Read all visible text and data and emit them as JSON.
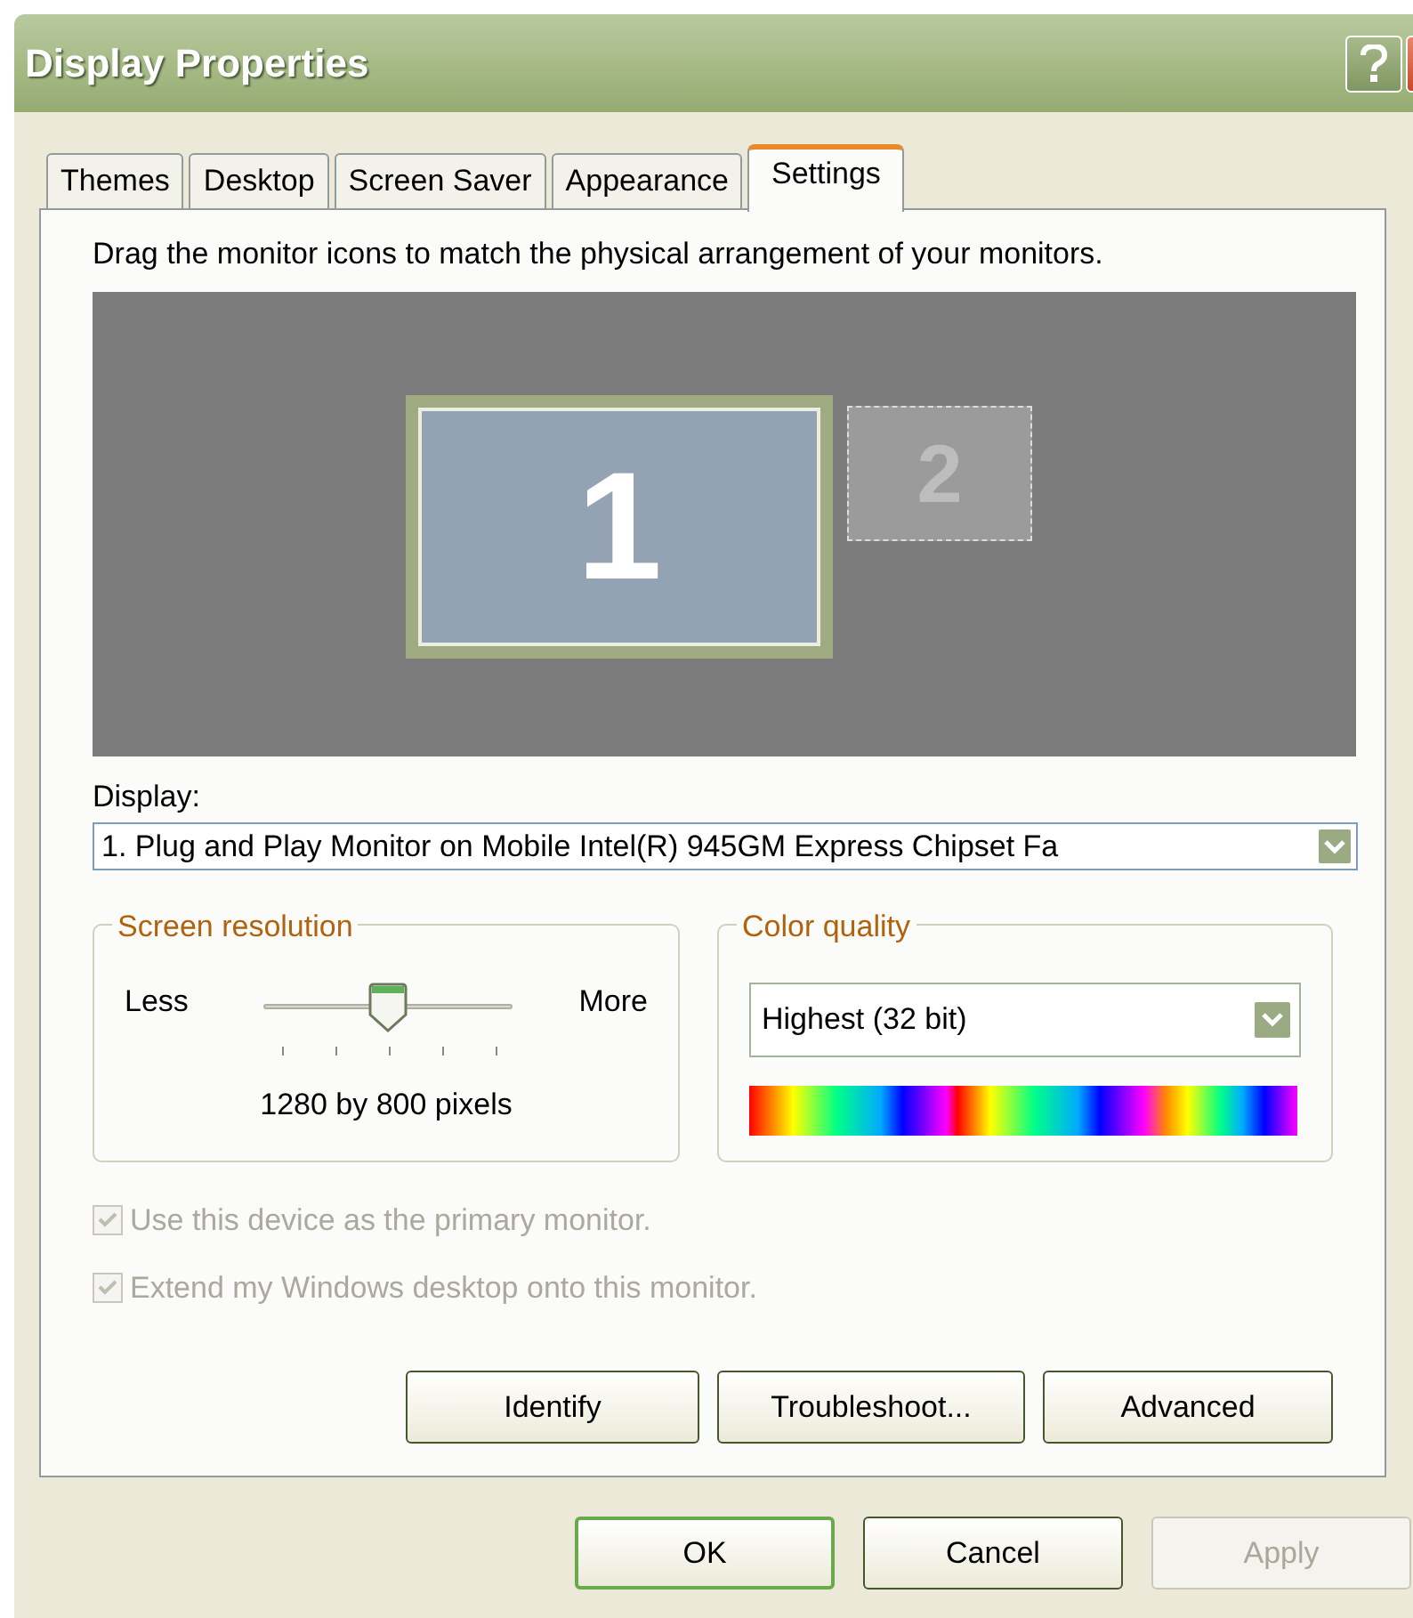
{
  "window": {
    "title": "Display Properties"
  },
  "tabs": [
    {
      "label": "Themes",
      "selected": false
    },
    {
      "label": "Desktop",
      "selected": false
    },
    {
      "label": "Screen Saver",
      "selected": false
    },
    {
      "label": "Appearance",
      "selected": false
    },
    {
      "label": "Settings",
      "selected": true
    }
  ],
  "instruction": "Drag the monitor icons to match the physical arrangement of your monitors.",
  "monitors": [
    {
      "label": "1",
      "selected": true
    },
    {
      "label": "2",
      "selected": false
    }
  ],
  "display": {
    "label": "Display:",
    "value": "1. Plug and Play Monitor on Mobile Intel(R) 945GM Express Chipset Fa"
  },
  "screen_resolution": {
    "title": "Screen resolution",
    "min_label": "Less",
    "max_label": "More",
    "level": 0.5,
    "reading": "1280 by 800 pixels"
  },
  "color_quality": {
    "title": "Color quality",
    "value": "Highest (32 bit)"
  },
  "checkboxes": [
    {
      "label": "Use this device as the primary monitor.",
      "checked": true,
      "disabled": true
    },
    {
      "label": "Extend my Windows desktop onto this monitor.",
      "checked": true,
      "disabled": true
    }
  ],
  "panel_buttons": [
    {
      "label": "Identify"
    },
    {
      "label": "Troubleshoot..."
    },
    {
      "label": "Advanced"
    }
  ],
  "dialog_buttons": [
    {
      "label": "OK",
      "default": true,
      "disabled": false
    },
    {
      "label": "Cancel",
      "default": false,
      "disabled": false
    },
    {
      "label": "Apply",
      "default": false,
      "disabled": true
    }
  ]
}
